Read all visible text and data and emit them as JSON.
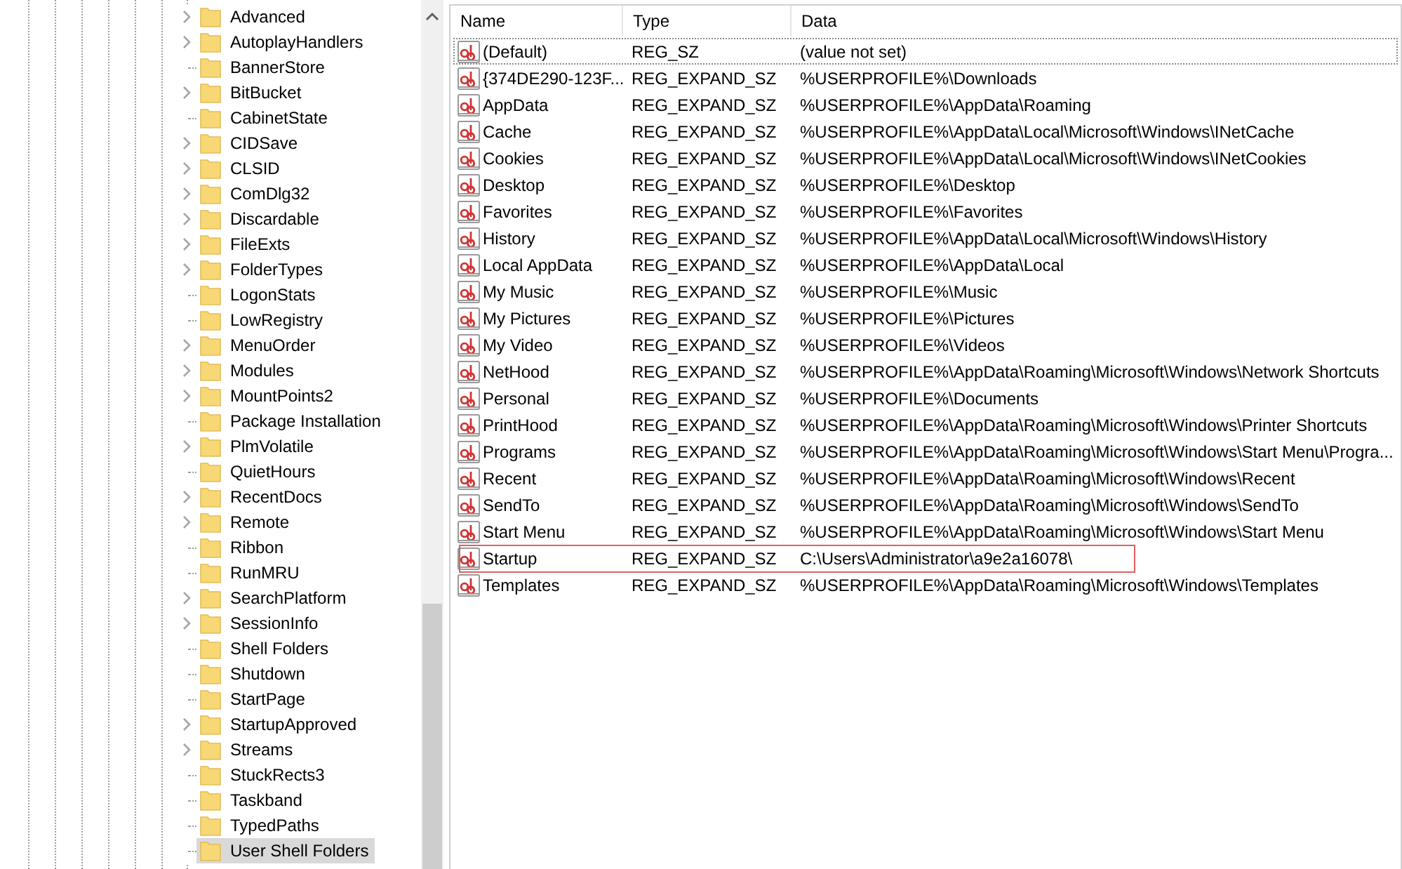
{
  "tree": {
    "items": [
      {
        "label": "Advanced",
        "expandable": true,
        "selected": false
      },
      {
        "label": "AutoplayHandlers",
        "expandable": true,
        "selected": false
      },
      {
        "label": "BannerStore",
        "expandable": false,
        "selected": false
      },
      {
        "label": "BitBucket",
        "expandable": true,
        "selected": false
      },
      {
        "label": "CabinetState",
        "expandable": false,
        "selected": false
      },
      {
        "label": "CIDSave",
        "expandable": true,
        "selected": false
      },
      {
        "label": "CLSID",
        "expandable": true,
        "selected": false
      },
      {
        "label": "ComDlg32",
        "expandable": true,
        "selected": false
      },
      {
        "label": "Discardable",
        "expandable": true,
        "selected": false
      },
      {
        "label": "FileExts",
        "expandable": true,
        "selected": false
      },
      {
        "label": "FolderTypes",
        "expandable": true,
        "selected": false
      },
      {
        "label": "LogonStats",
        "expandable": false,
        "selected": false
      },
      {
        "label": "LowRegistry",
        "expandable": false,
        "selected": false
      },
      {
        "label": "MenuOrder",
        "expandable": true,
        "selected": false
      },
      {
        "label": "Modules",
        "expandable": true,
        "selected": false
      },
      {
        "label": "MountPoints2",
        "expandable": true,
        "selected": false
      },
      {
        "label": "Package Installation",
        "expandable": false,
        "selected": false
      },
      {
        "label": "PlmVolatile",
        "expandable": true,
        "selected": false
      },
      {
        "label": "QuietHours",
        "expandable": false,
        "selected": false
      },
      {
        "label": "RecentDocs",
        "expandable": true,
        "selected": false
      },
      {
        "label": "Remote",
        "expandable": true,
        "selected": false
      },
      {
        "label": "Ribbon",
        "expandable": false,
        "selected": false
      },
      {
        "label": "RunMRU",
        "expandable": false,
        "selected": false
      },
      {
        "label": "SearchPlatform",
        "expandable": true,
        "selected": false
      },
      {
        "label": "SessionInfo",
        "expandable": true,
        "selected": false
      },
      {
        "label": "Shell Folders",
        "expandable": false,
        "selected": false
      },
      {
        "label": "Shutdown",
        "expandable": false,
        "selected": false
      },
      {
        "label": "StartPage",
        "expandable": false,
        "selected": false
      },
      {
        "label": "StartupApproved",
        "expandable": true,
        "selected": false
      },
      {
        "label": "Streams",
        "expandable": true,
        "selected": false
      },
      {
        "label": "StuckRects3",
        "expandable": false,
        "selected": false
      },
      {
        "label": "Taskband",
        "expandable": false,
        "selected": false
      },
      {
        "label": "TypedPaths",
        "expandable": false,
        "selected": false
      },
      {
        "label": "User Shell Folders",
        "expandable": false,
        "selected": true
      }
    ]
  },
  "table": {
    "columns": [
      "Name",
      "Type",
      "Data"
    ],
    "rows": [
      {
        "name": "(Default)",
        "type": "REG_SZ",
        "data": "(value not set)",
        "focused": true,
        "annotated": false
      },
      {
        "name": "{374DE290-123F...",
        "type": "REG_EXPAND_SZ",
        "data": "%USERPROFILE%\\Downloads",
        "focused": false,
        "annotated": false
      },
      {
        "name": "AppData",
        "type": "REG_EXPAND_SZ",
        "data": "%USERPROFILE%\\AppData\\Roaming",
        "focused": false,
        "annotated": false
      },
      {
        "name": "Cache",
        "type": "REG_EXPAND_SZ",
        "data": "%USERPROFILE%\\AppData\\Local\\Microsoft\\Windows\\INetCache",
        "focused": false,
        "annotated": false
      },
      {
        "name": "Cookies",
        "type": "REG_EXPAND_SZ",
        "data": "%USERPROFILE%\\AppData\\Local\\Microsoft\\Windows\\INetCookies",
        "focused": false,
        "annotated": false
      },
      {
        "name": "Desktop",
        "type": "REG_EXPAND_SZ",
        "data": "%USERPROFILE%\\Desktop",
        "focused": false,
        "annotated": false
      },
      {
        "name": "Favorites",
        "type": "REG_EXPAND_SZ",
        "data": "%USERPROFILE%\\Favorites",
        "focused": false,
        "annotated": false
      },
      {
        "name": "History",
        "type": "REG_EXPAND_SZ",
        "data": "%USERPROFILE%\\AppData\\Local\\Microsoft\\Windows\\History",
        "focused": false,
        "annotated": false
      },
      {
        "name": "Local AppData",
        "type": "REG_EXPAND_SZ",
        "data": "%USERPROFILE%\\AppData\\Local",
        "focused": false,
        "annotated": false
      },
      {
        "name": "My Music",
        "type": "REG_EXPAND_SZ",
        "data": "%USERPROFILE%\\Music",
        "focused": false,
        "annotated": false
      },
      {
        "name": "My Pictures",
        "type": "REG_EXPAND_SZ",
        "data": "%USERPROFILE%\\Pictures",
        "focused": false,
        "annotated": false
      },
      {
        "name": "My Video",
        "type": "REG_EXPAND_SZ",
        "data": "%USERPROFILE%\\Videos",
        "focused": false,
        "annotated": false
      },
      {
        "name": "NetHood",
        "type": "REG_EXPAND_SZ",
        "data": "%USERPROFILE%\\AppData\\Roaming\\Microsoft\\Windows\\Network Shortcuts",
        "focused": false,
        "annotated": false
      },
      {
        "name": "Personal",
        "type": "REG_EXPAND_SZ",
        "data": "%USERPROFILE%\\Documents",
        "focused": false,
        "annotated": false
      },
      {
        "name": "PrintHood",
        "type": "REG_EXPAND_SZ",
        "data": "%USERPROFILE%\\AppData\\Roaming\\Microsoft\\Windows\\Printer Shortcuts",
        "focused": false,
        "annotated": false
      },
      {
        "name": "Programs",
        "type": "REG_EXPAND_SZ",
        "data": "%USERPROFILE%\\AppData\\Roaming\\Microsoft\\Windows\\Start Menu\\Progra...",
        "focused": false,
        "annotated": false
      },
      {
        "name": "Recent",
        "type": "REG_EXPAND_SZ",
        "data": "%USERPROFILE%\\AppData\\Roaming\\Microsoft\\Windows\\Recent",
        "focused": false,
        "annotated": false
      },
      {
        "name": "SendTo",
        "type": "REG_EXPAND_SZ",
        "data": "%USERPROFILE%\\AppData\\Roaming\\Microsoft\\Windows\\SendTo",
        "focused": false,
        "annotated": false
      },
      {
        "name": "Start Menu",
        "type": "REG_EXPAND_SZ",
        "data": "%USERPROFILE%\\AppData\\Roaming\\Microsoft\\Windows\\Start Menu",
        "focused": false,
        "annotated": false
      },
      {
        "name": "Startup",
        "type": "REG_EXPAND_SZ",
        "data": "C:\\Users\\Administrator\\a9e2a16078\\",
        "focused": false,
        "annotated": true
      },
      {
        "name": "Templates",
        "type": "REG_EXPAND_SZ",
        "data": "%USERPROFILE%\\AppData\\Roaming\\Microsoft\\Windows\\Templates",
        "focused": false,
        "annotated": false
      }
    ]
  }
}
